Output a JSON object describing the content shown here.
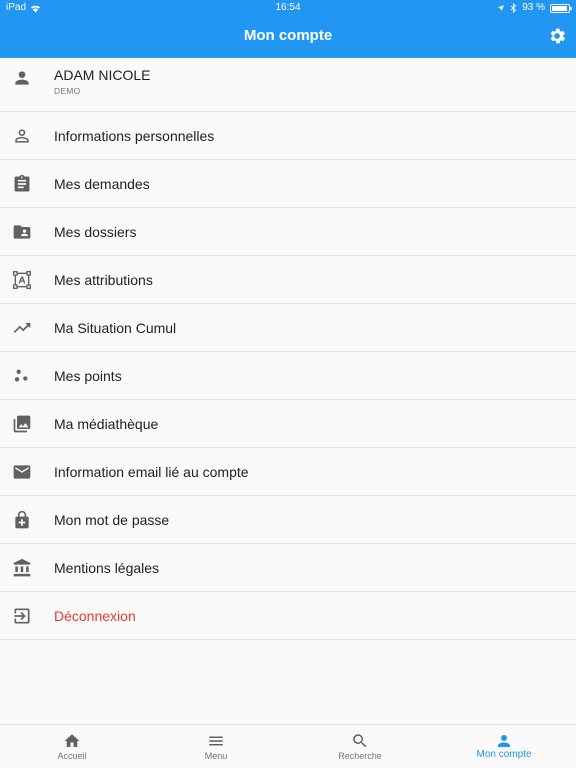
{
  "status_bar": {
    "device": "iPad",
    "time": "16:54",
    "battery": "93 %",
    "battery_level": 0.93
  },
  "app_bar": {
    "title": "Mon compte",
    "settings_icon": "gear-icon"
  },
  "user": {
    "name": "ADAM NICOLE",
    "subtitle": "DEMO",
    "icon": "person-icon"
  },
  "menu": [
    {
      "label": "Informations personnelles",
      "icon": "person-outline-icon"
    },
    {
      "label": "Mes demandes",
      "icon": "clipboard-icon"
    },
    {
      "label": "Mes dossiers",
      "icon": "folder-shared-icon"
    },
    {
      "label": "Mes attributions",
      "icon": "attribution-frame-icon"
    },
    {
      "label": "Ma Situation Cumul",
      "icon": "trending-up-icon"
    },
    {
      "label": "Mes points",
      "icon": "points-icon"
    },
    {
      "label": "Ma médiathèque",
      "icon": "photo-library-icon"
    },
    {
      "label": "Information email lié au compte",
      "icon": "email-icon"
    },
    {
      "label": "Mon mot de passe",
      "icon": "lock-icon"
    },
    {
      "label": "Mentions légales",
      "icon": "bank-icon"
    },
    {
      "label": "Déconnexion",
      "icon": "logout-icon"
    }
  ],
  "bottom_nav": [
    {
      "label": "Accueil",
      "icon": "home-icon"
    },
    {
      "label": "Menu",
      "icon": "menu-icon"
    },
    {
      "label": "Recherche",
      "icon": "search-icon"
    },
    {
      "label": "Mon compte",
      "icon": "account-icon",
      "active": true
    }
  ],
  "colors": {
    "primary": "#2196f3",
    "logout": "#e53935",
    "icon": "#616161"
  }
}
